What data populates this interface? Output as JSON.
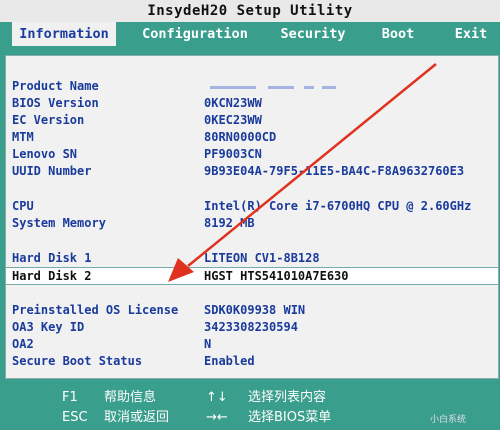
{
  "window": {
    "title": "InsydeH20 Setup Utility"
  },
  "tabs": [
    {
      "label": "Information",
      "active": true
    },
    {
      "label": "Configuration",
      "active": false
    },
    {
      "label": "Security",
      "active": false
    },
    {
      "label": "Boot",
      "active": false
    },
    {
      "label": "Exit",
      "active": false
    }
  ],
  "info": {
    "product_name": {
      "label": "Product Name",
      "value": ""
    },
    "bios_version": {
      "label": "BIOS Version",
      "value": "0KCN23WW"
    },
    "ec_version": {
      "label": "EC Version",
      "value": "0KEC23WW"
    },
    "mtm": {
      "label": "MTM",
      "value": "80RN0000CD"
    },
    "lenovo_sn": {
      "label": "Lenovo SN",
      "value": "PF9003CN"
    },
    "uuid": {
      "label": "UUID Number",
      "value": "9B93E04A-79F5-11E5-BA4C-F8A9632760E3"
    },
    "cpu": {
      "label": "CPU",
      "value": "Intel(R) Core i7-6700HQ CPU @ 2.60GHz"
    },
    "memory": {
      "label": "System Memory",
      "value": "8192 MB"
    },
    "hdd1": {
      "label": "Hard Disk 1",
      "value": "LITEON CV1-8B128"
    },
    "hdd2": {
      "label": "Hard Disk 2",
      "value": "HGST HTS541010A7E630"
    },
    "os_license": {
      "label": "Preinstalled OS License",
      "value": "SDK0K09938 WIN"
    },
    "oa3_key": {
      "label": "OA3 Key ID",
      "value": "3423308230594"
    },
    "oa2": {
      "label": "OA2",
      "value": "N"
    },
    "secure_boot": {
      "label": "Secure Boot Status",
      "value": "Enabled"
    }
  },
  "footer": {
    "f1_key": "F1",
    "f1_desc": "帮助信息",
    "esc_key": "ESC",
    "esc_desc": "取消或返回",
    "nav_key": "↑↓",
    "nav_desc": "选择列表内容",
    "lr_key": "→←",
    "lr_desc": "选择BIOS菜单",
    "watermark": "小白系统"
  },
  "annotation": {
    "arrow_color": "#e0321f"
  }
}
